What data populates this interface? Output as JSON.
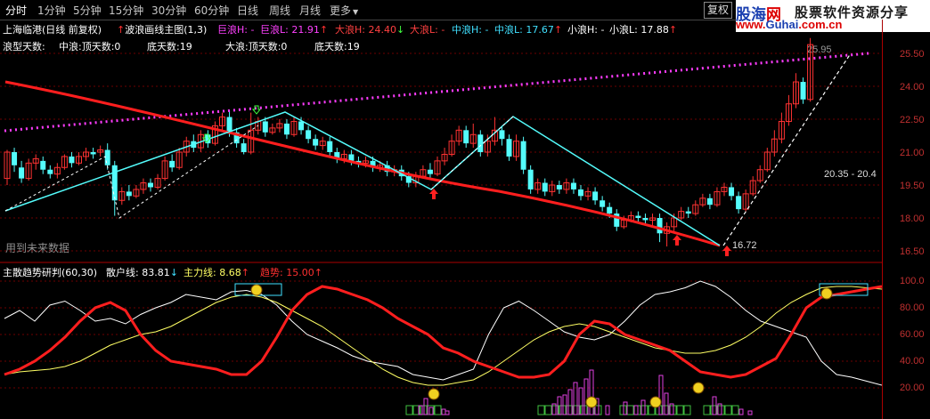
{
  "toolbar": {
    "tabs": [
      "分时",
      "1分钟",
      "5分钟",
      "15分钟",
      "30分钟",
      "60分钟",
      "日线",
      "周线",
      "月线",
      "更多"
    ],
    "more_arrow": "▼",
    "fuquan": "复权",
    "nav": "◄ ►"
  },
  "logo": {
    "name_a": "股海",
    "name_b": "网",
    "slogan": "股票软件资源分享",
    "url_a": "www.",
    "url_b": "Guhai",
    "url_c": ".com.cn"
  },
  "main_panel": {
    "title": "上海临港(日线 前复权)",
    "indicator_name": "波浪画线主图(1,3)",
    "waves": [
      {
        "label": "巨浪H: -",
        "color": "#ff40ff"
      },
      {
        "label": "巨浪L: 21.91",
        "color": "#ff40ff",
        "arrow": "↑"
      },
      {
        "label": "大浪H: 24.40",
        "color": "#ff4040",
        "arrow": "↓"
      },
      {
        "label": "大浪L: -",
        "color": "#ff4040"
      },
      {
        "label": "中浪H: -",
        "color": "#40e0ff"
      },
      {
        "label": "中浪L: 17.67",
        "color": "#40e0ff",
        "arrow": "↑"
      },
      {
        "label": "小浪H: -",
        "color": "#ffffff"
      },
      {
        "label": "小浪L: 17.88",
        "color": "#ffffff",
        "arrow": "↑"
      }
    ],
    "line2": [
      "浪型天数:",
      "中浪:顶天数:0",
      "底天数:19",
      "大浪:顶天数:0",
      "底天数:19"
    ],
    "future_note": "用到未来数据",
    "price_labels": {
      "low": "16.72",
      "high": "25.95",
      "range": "20.35 - 20.4"
    },
    "y_ticks": [
      "25.50",
      "24.00",
      "22.50",
      "21.00",
      "19.50",
      "18.00",
      "16.50"
    ]
  },
  "sub_panel": {
    "title": "主散趋势研判(60,30)",
    "retail": "散户线: 83.81",
    "retail_arrow": "↓",
    "main_force": "主力线: 8.68",
    "main_arrow": "↑",
    "trend": "趋势: 15.00",
    "trend_arrow": "↑",
    "y_ticks": [
      "100.0",
      "80.00",
      "60.00",
      "40.00",
      "20.00"
    ]
  },
  "colors": {
    "up": "#ff3232",
    "down": "#54fcfc",
    "trend_red": "#ff1e1e",
    "dots": "#ff3cff",
    "retail_line": "#ffffff",
    "main_line": "#ffff64",
    "grid": "#6e0000"
  }
}
